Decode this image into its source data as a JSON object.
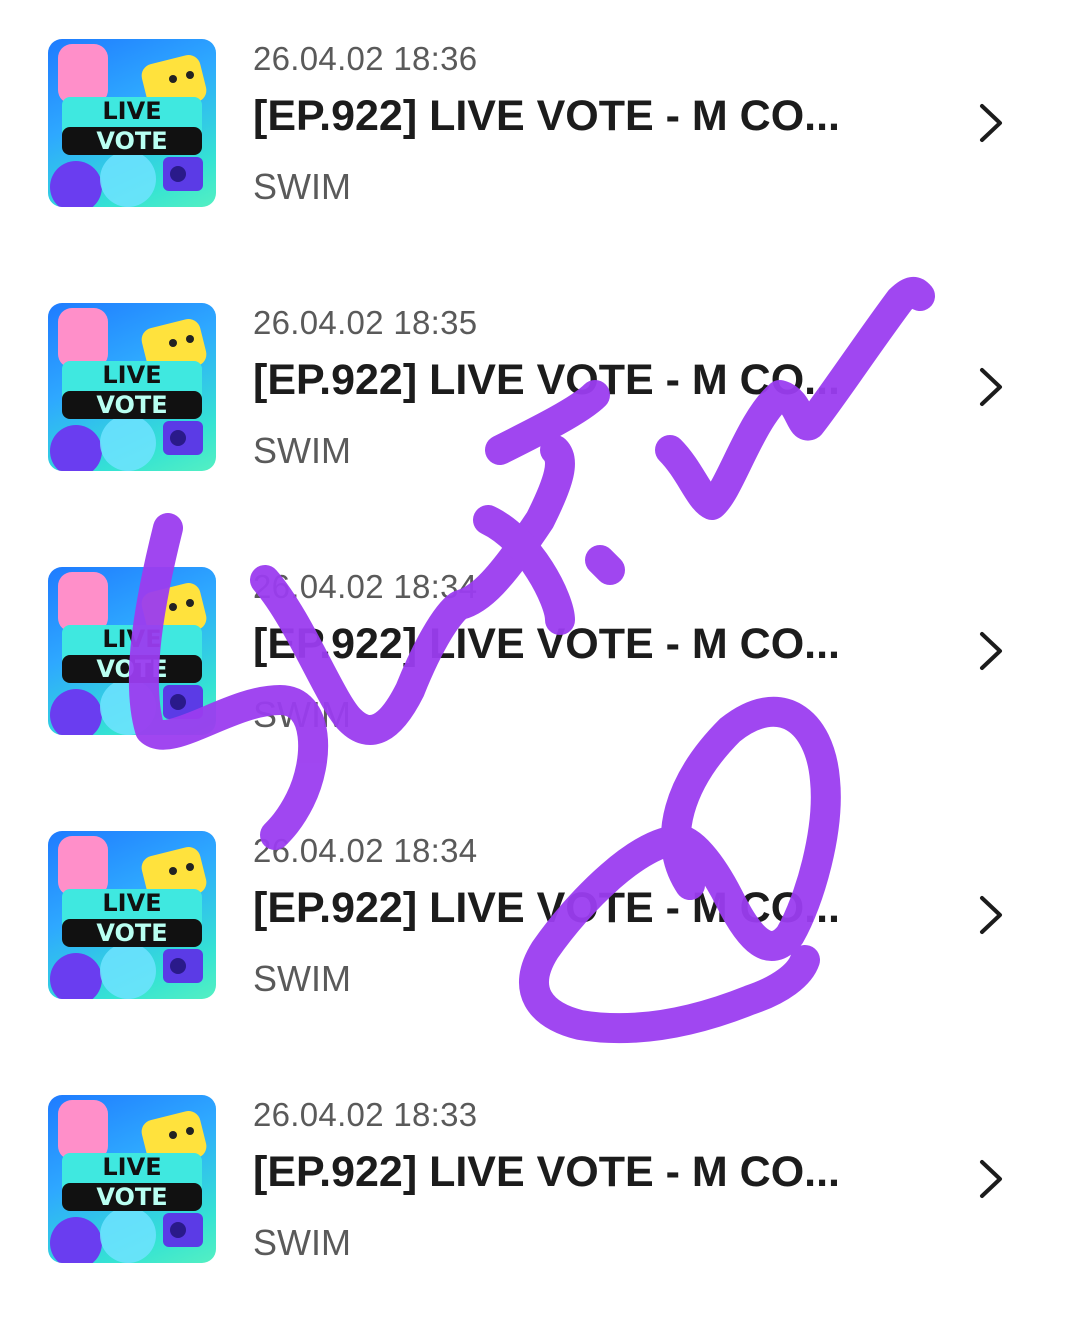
{
  "thumbnail": {
    "line1": "LIVE",
    "line2": "VOTE"
  },
  "items": [
    {
      "date": "26.04.02 18:36",
      "title": "[EP.922] LIVE VOTE - M CO...",
      "author": "SWIM"
    },
    {
      "date": "26.04.02 18:35",
      "title": "[EP.922] LIVE VOTE - M CO...",
      "author": "SWIM"
    },
    {
      "date": "26.04.02 18:34",
      "title": "[EP.922] LIVE VOTE - M CO...",
      "author": "SWIM"
    },
    {
      "date": "26.04.02 18:34",
      "title": "[EP.922] LIVE VOTE - M CO...",
      "author": "SWIM"
    },
    {
      "date": "26.04.02 18:33",
      "title": "[EP.922] LIVE VOTE - M CO...",
      "author": "SWIM"
    }
  ],
  "icons": {
    "row_chevron": "chevron-right-icon"
  },
  "colors": {
    "scribble": "#9b3df0",
    "title_text": "#1c1c1c",
    "meta_text": "#5a5a5a",
    "background": "#ffffff"
  }
}
